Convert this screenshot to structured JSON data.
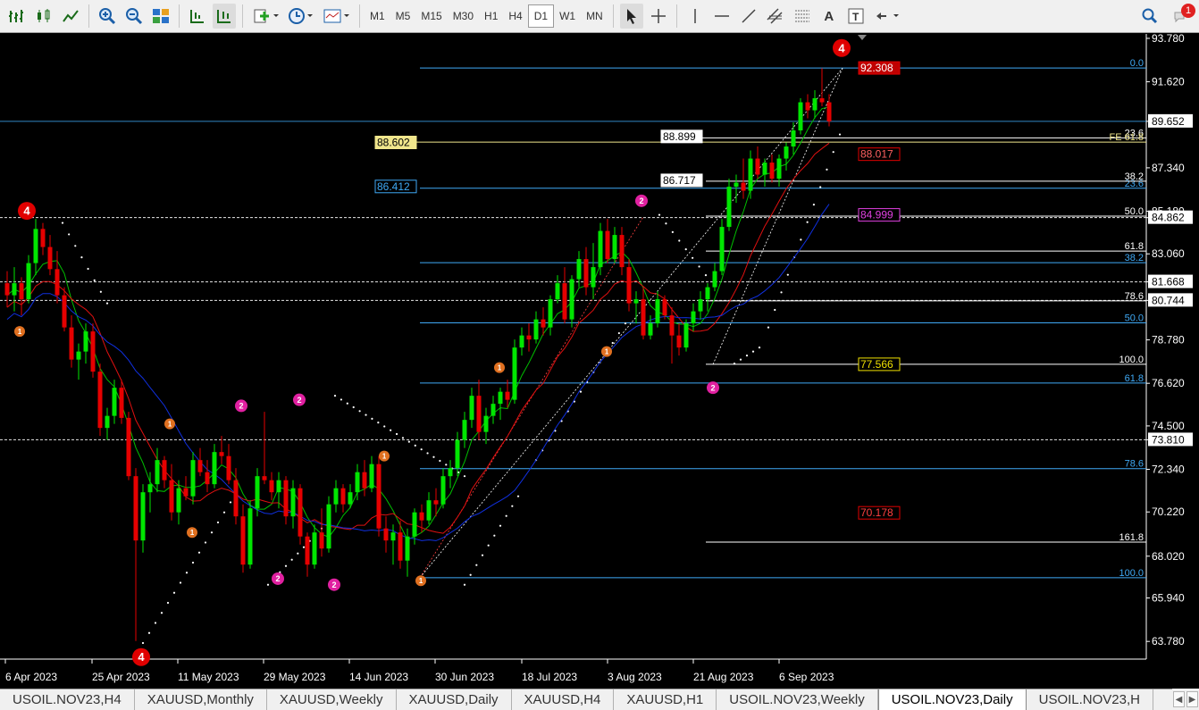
{
  "toolbar": {
    "timeframes": [
      "M1",
      "M5",
      "M15",
      "M30",
      "H1",
      "H4",
      "D1",
      "W1",
      "MN"
    ],
    "active_timeframe": "D1",
    "notification_count": "1"
  },
  "price_axis": {
    "ticks": [
      "93.780",
      "91.620",
      "89.652",
      "87.340",
      "85.180",
      "84.862",
      "83.060",
      "81.668",
      "80.744",
      "78.780",
      "76.620",
      "74.500",
      "73.810",
      "72.340",
      "70.220",
      "68.020",
      "65.940",
      "63.780"
    ],
    "current_price": "89.652"
  },
  "time_axis": [
    "6 Apr 2023",
    "25 Apr 2023",
    "11 May 2023",
    "29 May 2023",
    "14 Jun 2023",
    "30 Jun 2023",
    "18 Jul 2023",
    "3 Aug 2023",
    "21 Aug 2023",
    "6 Sep 2023"
  ],
  "price_labels": {
    "high_red": "92.308",
    "level_88_899": "88.899",
    "level_88_602": "88.602",
    "level_88_017": "88.017",
    "level_86_717": "86.717",
    "level_86_412": "86.412",
    "level_84_999": "84.999",
    "level_77_566": "77.566",
    "level_70_178": "70.178"
  },
  "fib_labels": {
    "fib_0": "0.0",
    "fe_61_8": "FE 61.8",
    "fib_23_6": "23.6",
    "fib_38_2_white": "38.2",
    "fib_23_6_blue": "23.6",
    "fib_50_white": "50.0",
    "fib_61_8_white": "61.8",
    "fib_38_2_blue": "38.2",
    "fib_78_6_white": "78.6",
    "fib_50_blue": "50.0",
    "fib_100_white": "100.0",
    "fib_61_8_blue": "61.8",
    "fib_78_6_blue": "78.6",
    "fib_161_8": "161.8",
    "fib_100_blue": "100.0"
  },
  "wave_labels": {
    "wave_4_top": "4",
    "wave_4_left": "4",
    "wave_4_bottom": "4",
    "wave_1": "1",
    "wave_2": "2"
  },
  "tabs": [
    "USOIL.NOV23,H4",
    "XAUUSD,Monthly",
    "XAUUSD,Weekly",
    "XAUUSD,Daily",
    "XAUUSD,H4",
    "XAUUSD,H1",
    "USOIL.NOV23,Weekly",
    "USOIL.NOV23,Daily",
    "USOIL.NOV23,H"
  ],
  "active_tab": "USOIL.NOV23,Daily",
  "colors": {
    "bull": "#00e600",
    "bear": "#e60000",
    "fib_blue": "#3fa9f5",
    "fib_white": "#ffffff",
    "ma_fast": "#00c000",
    "ma_mid": "#e01010",
    "ma_slow": "#1030e0"
  },
  "chart_data": {
    "type": "candlestick",
    "symbol": "USOIL.NOV23",
    "timeframe": "D1",
    "candles": [
      {
        "o": 81.6,
        "h": 82.2,
        "l": 80.4,
        "c": 81.0
      },
      {
        "o": 81.0,
        "h": 82.4,
        "l": 80.2,
        "c": 81.6
      },
      {
        "o": 81.6,
        "h": 81.9,
        "l": 80.0,
        "c": 80.8
      },
      {
        "o": 80.8,
        "h": 83.0,
        "l": 80.6,
        "c": 82.6
      },
      {
        "o": 82.6,
        "h": 84.8,
        "l": 82.0,
        "c": 84.3
      },
      {
        "o": 84.3,
        "h": 84.6,
        "l": 83.0,
        "c": 83.4
      },
      {
        "o": 83.4,
        "h": 84.0,
        "l": 82.0,
        "c": 82.3
      },
      {
        "o": 82.3,
        "h": 83.2,
        "l": 80.6,
        "c": 81.0
      },
      {
        "o": 81.0,
        "h": 81.4,
        "l": 79.2,
        "c": 79.4
      },
      {
        "o": 79.4,
        "h": 80.0,
        "l": 77.4,
        "c": 77.8
      },
      {
        "o": 77.8,
        "h": 78.6,
        "l": 76.8,
        "c": 78.2
      },
      {
        "o": 78.2,
        "h": 79.6,
        "l": 77.6,
        "c": 79.2
      },
      {
        "o": 79.2,
        "h": 79.6,
        "l": 76.9,
        "c": 77.2
      },
      {
        "o": 77.2,
        "h": 77.6,
        "l": 74.0,
        "c": 74.4
      },
      {
        "o": 74.4,
        "h": 75.4,
        "l": 73.8,
        "c": 75.0
      },
      {
        "o": 75.0,
        "h": 76.8,
        "l": 74.6,
        "c": 76.4
      },
      {
        "o": 76.4,
        "h": 76.8,
        "l": 74.6,
        "c": 74.9
      },
      {
        "o": 74.9,
        "h": 75.2,
        "l": 71.8,
        "c": 72.0
      },
      {
        "o": 72.0,
        "h": 72.4,
        "l": 63.8,
        "c": 68.8
      },
      {
        "o": 68.8,
        "h": 71.6,
        "l": 68.2,
        "c": 71.2
      },
      {
        "o": 71.2,
        "h": 72.2,
        "l": 70.2,
        "c": 71.6
      },
      {
        "o": 71.6,
        "h": 73.4,
        "l": 71.2,
        "c": 72.8
      },
      {
        "o": 72.8,
        "h": 73.0,
        "l": 71.4,
        "c": 71.8
      },
      {
        "o": 71.8,
        "h": 72.6,
        "l": 69.8,
        "c": 70.2
      },
      {
        "o": 70.2,
        "h": 71.8,
        "l": 69.6,
        "c": 71.4
      },
      {
        "o": 71.4,
        "h": 72.0,
        "l": 70.8,
        "c": 71.0
      },
      {
        "o": 71.0,
        "h": 73.2,
        "l": 70.6,
        "c": 72.8
      },
      {
        "o": 72.8,
        "h": 73.4,
        "l": 72.0,
        "c": 72.2
      },
      {
        "o": 72.2,
        "h": 72.8,
        "l": 71.2,
        "c": 71.6
      },
      {
        "o": 71.6,
        "h": 73.6,
        "l": 71.4,
        "c": 73.2
      },
      {
        "o": 73.2,
        "h": 74.0,
        "l": 72.6,
        "c": 73.0
      },
      {
        "o": 73.0,
        "h": 73.6,
        "l": 71.6,
        "c": 71.8
      },
      {
        "o": 71.8,
        "h": 72.4,
        "l": 69.6,
        "c": 70.0
      },
      {
        "o": 70.0,
        "h": 70.6,
        "l": 67.2,
        "c": 67.6
      },
      {
        "o": 67.6,
        "h": 70.8,
        "l": 67.4,
        "c": 70.4
      },
      {
        "o": 70.4,
        "h": 72.4,
        "l": 70.0,
        "c": 72.0
      },
      {
        "o": 72.0,
        "h": 75.2,
        "l": 71.6,
        "c": 71.8
      },
      {
        "o": 71.8,
        "h": 72.2,
        "l": 70.8,
        "c": 71.2
      },
      {
        "o": 71.2,
        "h": 72.2,
        "l": 70.4,
        "c": 71.8
      },
      {
        "o": 71.8,
        "h": 72.0,
        "l": 69.6,
        "c": 70.0
      },
      {
        "o": 70.0,
        "h": 71.8,
        "l": 69.4,
        "c": 71.4
      },
      {
        "o": 71.4,
        "h": 71.6,
        "l": 68.6,
        "c": 69.0
      },
      {
        "o": 69.0,
        "h": 69.2,
        "l": 67.0,
        "c": 67.6
      },
      {
        "o": 67.6,
        "h": 69.6,
        "l": 67.4,
        "c": 69.2
      },
      {
        "o": 69.2,
        "h": 70.4,
        "l": 68.0,
        "c": 68.4
      },
      {
        "o": 68.4,
        "h": 71.0,
        "l": 68.2,
        "c": 70.6
      },
      {
        "o": 70.6,
        "h": 71.8,
        "l": 70.2,
        "c": 71.4
      },
      {
        "o": 71.4,
        "h": 71.6,
        "l": 70.2,
        "c": 70.6
      },
      {
        "o": 70.6,
        "h": 71.6,
        "l": 70.4,
        "c": 71.2
      },
      {
        "o": 71.2,
        "h": 72.6,
        "l": 70.8,
        "c": 72.2
      },
      {
        "o": 72.2,
        "h": 72.8,
        "l": 71.0,
        "c": 71.4
      },
      {
        "o": 71.4,
        "h": 73.0,
        "l": 71.2,
        "c": 72.6
      },
      {
        "o": 72.6,
        "h": 73.0,
        "l": 69.0,
        "c": 69.4
      },
      {
        "o": 69.4,
        "h": 70.0,
        "l": 68.2,
        "c": 68.8
      },
      {
        "o": 68.8,
        "h": 69.6,
        "l": 67.6,
        "c": 69.2
      },
      {
        "o": 69.2,
        "h": 69.8,
        "l": 67.4,
        "c": 67.8
      },
      {
        "o": 67.8,
        "h": 69.4,
        "l": 67.0,
        "c": 69.0
      },
      {
        "o": 69.0,
        "h": 70.4,
        "l": 68.6,
        "c": 70.2
      },
      {
        "o": 70.2,
        "h": 70.6,
        "l": 69.2,
        "c": 69.8
      },
      {
        "o": 69.8,
        "h": 71.2,
        "l": 69.6,
        "c": 70.8
      },
      {
        "o": 70.8,
        "h": 71.4,
        "l": 70.0,
        "c": 70.6
      },
      {
        "o": 70.6,
        "h": 72.4,
        "l": 70.4,
        "c": 72.0
      },
      {
        "o": 72.0,
        "h": 72.8,
        "l": 71.4,
        "c": 72.4
      },
      {
        "o": 72.4,
        "h": 74.2,
        "l": 72.0,
        "c": 73.8
      },
      {
        "o": 73.8,
        "h": 75.2,
        "l": 73.4,
        "c": 74.8
      },
      {
        "o": 74.8,
        "h": 76.4,
        "l": 74.4,
        "c": 76.0
      },
      {
        "o": 76.0,
        "h": 76.8,
        "l": 73.8,
        "c": 74.2
      },
      {
        "o": 74.2,
        "h": 75.4,
        "l": 73.6,
        "c": 75.0
      },
      {
        "o": 75.0,
        "h": 76.0,
        "l": 74.6,
        "c": 75.6
      },
      {
        "o": 75.6,
        "h": 76.4,
        "l": 74.8,
        "c": 76.2
      },
      {
        "o": 76.2,
        "h": 76.8,
        "l": 75.4,
        "c": 75.8
      },
      {
        "o": 75.8,
        "h": 78.8,
        "l": 75.6,
        "c": 78.4
      },
      {
        "o": 78.4,
        "h": 79.4,
        "l": 78.0,
        "c": 79.0
      },
      {
        "o": 79.0,
        "h": 79.6,
        "l": 78.2,
        "c": 78.8
      },
      {
        "o": 78.8,
        "h": 80.2,
        "l": 78.6,
        "c": 79.8
      },
      {
        "o": 79.8,
        "h": 80.4,
        "l": 79.0,
        "c": 79.4
      },
      {
        "o": 79.4,
        "h": 81.0,
        "l": 79.0,
        "c": 80.8
      },
      {
        "o": 80.8,
        "h": 82.0,
        "l": 80.6,
        "c": 81.6
      },
      {
        "o": 81.6,
        "h": 82.4,
        "l": 79.6,
        "c": 79.8
      },
      {
        "o": 79.8,
        "h": 82.0,
        "l": 79.4,
        "c": 81.8
      },
      {
        "o": 81.8,
        "h": 83.2,
        "l": 81.4,
        "c": 82.8
      },
      {
        "o": 82.8,
        "h": 83.4,
        "l": 81.0,
        "c": 81.4
      },
      {
        "o": 81.4,
        "h": 83.6,
        "l": 80.8,
        "c": 82.4
      },
      {
        "o": 82.4,
        "h": 84.6,
        "l": 82.0,
        "c": 84.2
      },
      {
        "o": 84.2,
        "h": 84.8,
        "l": 82.6,
        "c": 82.8
      },
      {
        "o": 82.8,
        "h": 84.4,
        "l": 82.6,
        "c": 84.0
      },
      {
        "o": 84.0,
        "h": 84.4,
        "l": 82.0,
        "c": 82.4
      },
      {
        "o": 82.4,
        "h": 82.8,
        "l": 80.2,
        "c": 80.6
      },
      {
        "o": 80.6,
        "h": 81.2,
        "l": 79.6,
        "c": 80.8
      },
      {
        "o": 80.8,
        "h": 81.4,
        "l": 78.8,
        "c": 79.0
      },
      {
        "o": 79.0,
        "h": 80.0,
        "l": 78.8,
        "c": 79.6
      },
      {
        "o": 79.6,
        "h": 81.2,
        "l": 79.4,
        "c": 80.8
      },
      {
        "o": 80.8,
        "h": 81.0,
        "l": 79.8,
        "c": 80.0
      },
      {
        "o": 80.0,
        "h": 80.4,
        "l": 77.6,
        "c": 79.0
      },
      {
        "o": 79.0,
        "h": 79.6,
        "l": 78.0,
        "c": 78.4
      },
      {
        "o": 78.4,
        "h": 79.8,
        "l": 78.2,
        "c": 79.6
      },
      {
        "o": 79.6,
        "h": 80.6,
        "l": 79.2,
        "c": 80.2
      },
      {
        "o": 80.2,
        "h": 81.2,
        "l": 79.8,
        "c": 80.8
      },
      {
        "o": 80.8,
        "h": 81.6,
        "l": 80.2,
        "c": 81.4
      },
      {
        "o": 81.4,
        "h": 82.6,
        "l": 81.2,
        "c": 82.2
      },
      {
        "o": 82.2,
        "h": 84.8,
        "l": 82.0,
        "c": 84.4
      },
      {
        "o": 84.4,
        "h": 86.8,
        "l": 84.2,
        "c": 86.4
      },
      {
        "o": 86.4,
        "h": 87.0,
        "l": 85.6,
        "c": 86.6
      },
      {
        "o": 86.6,
        "h": 87.8,
        "l": 85.8,
        "c": 86.2
      },
      {
        "o": 86.2,
        "h": 88.2,
        "l": 85.8,
        "c": 87.8
      },
      {
        "o": 87.8,
        "h": 88.4,
        "l": 86.8,
        "c": 87.0
      },
      {
        "o": 87.0,
        "h": 87.8,
        "l": 86.4,
        "c": 87.6
      },
      {
        "o": 87.6,
        "h": 88.0,
        "l": 86.6,
        "c": 86.8
      },
      {
        "o": 86.8,
        "h": 88.0,
        "l": 86.4,
        "c": 87.8
      },
      {
        "o": 87.8,
        "h": 88.6,
        "l": 87.2,
        "c": 88.4
      },
      {
        "o": 88.4,
        "h": 89.6,
        "l": 88.0,
        "c": 89.2
      },
      {
        "o": 89.2,
        "h": 90.8,
        "l": 89.0,
        "c": 90.6
      },
      {
        "o": 90.6,
        "h": 91.0,
        "l": 89.8,
        "c": 90.2
      },
      {
        "o": 90.2,
        "h": 91.2,
        "l": 89.8,
        "c": 90.8
      },
      {
        "o": 90.8,
        "h": 92.3,
        "l": 90.4,
        "c": 90.6
      },
      {
        "o": 90.6,
        "h": 91.0,
        "l": 89.4,
        "c": 89.652
      }
    ],
    "horizontal_lines": [
      {
        "price": 89.652,
        "style": "solid",
        "color": "#3fa9f5"
      },
      {
        "price": 84.862,
        "style": "dashed",
        "color": "#ffffff"
      },
      {
        "price": 81.668,
        "style": "dashed",
        "color": "#ffffff"
      },
      {
        "price": 80.744,
        "style": "dashed",
        "color": "#ffffff"
      },
      {
        "price": 73.81,
        "style": "dashed",
        "color": "#ffffff"
      }
    ],
    "y_range": [
      62.9,
      94.0
    ]
  }
}
